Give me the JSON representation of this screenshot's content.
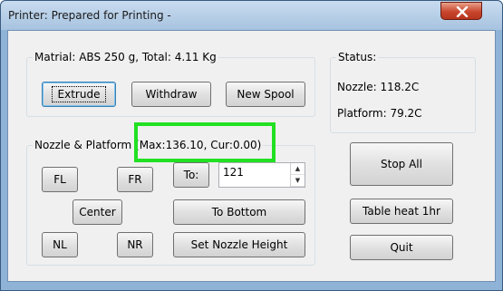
{
  "window": {
    "title": "Printer: Prepared for Printing -"
  },
  "material_group": {
    "legend": "Matrial: ABS 250 g,  Total: 4.11 Kg",
    "extrude_label": "Extrude",
    "withdraw_label": "Withdraw",
    "new_spool_label": "New Spool"
  },
  "status_group": {
    "legend": "Status:",
    "nozzle": "Nozzle: 118.2C",
    "platform": "Platform: 79.2C"
  },
  "nozzle_group": {
    "legend": "Nozzle & Platform (Max:136.10, Cur:0.00)",
    "fl_label": "FL",
    "fr_label": "FR",
    "to_label": "To:",
    "to_value": "121",
    "center_label": "Center",
    "to_bottom_label": "To Bottom",
    "nl_label": "NL",
    "nr_label": "NR",
    "set_nozzle_height_label": "Set Nozzle Height"
  },
  "actions": {
    "stop_all_label": "Stop All",
    "table_heat_label": "Table heat 1hr",
    "quit_label": "Quit"
  },
  "icons": {
    "close": "close-icon",
    "spin_up": "spin-up-arrow-icon",
    "spin_down": "spin-down-arrow-icon"
  },
  "colors": {
    "highlight": "#22e022",
    "close_button": "#c8462e"
  }
}
